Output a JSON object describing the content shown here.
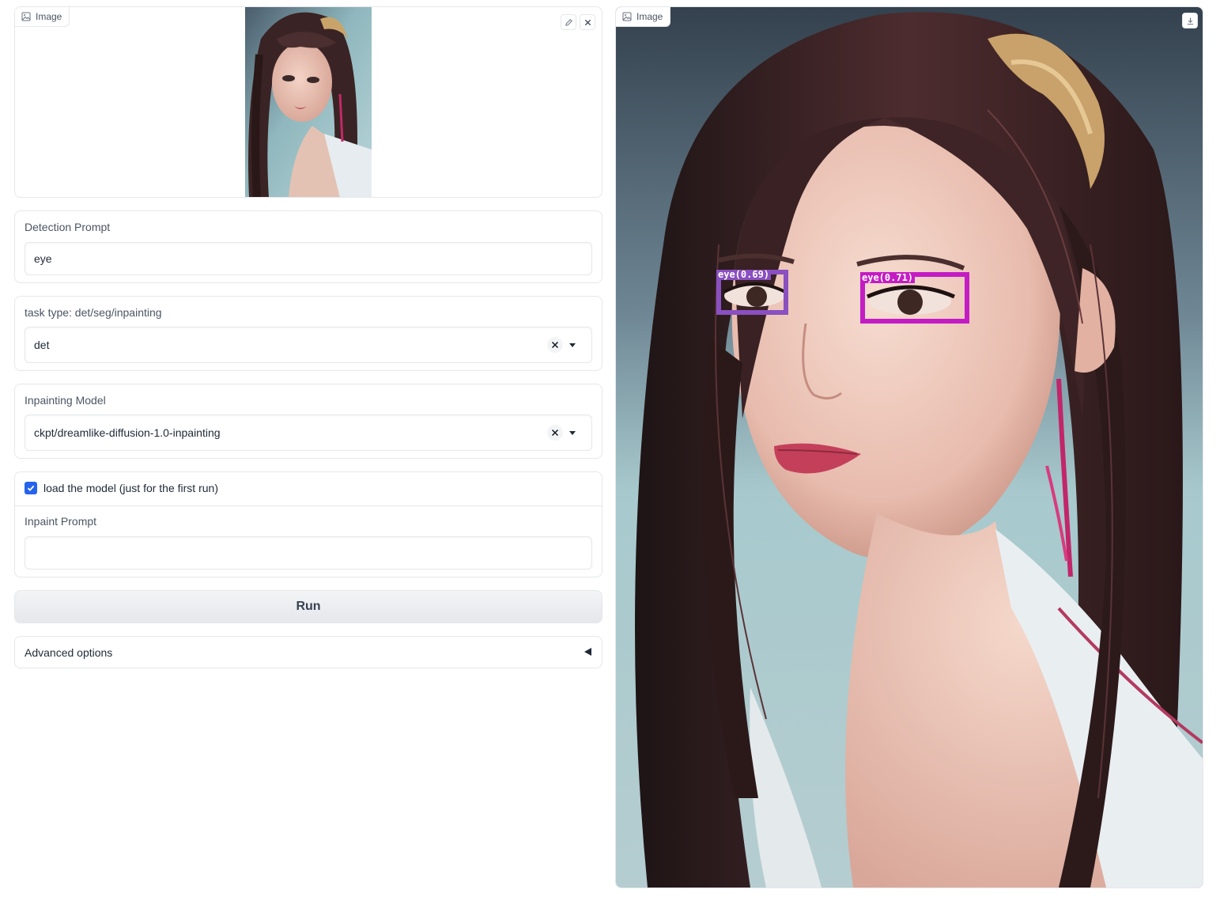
{
  "input_image": {
    "tag_label": "Image",
    "tag_icon": "image-icon",
    "edit_icon": "pencil-icon",
    "clear_icon": "close-icon"
  },
  "detection_prompt": {
    "label": "Detection Prompt",
    "value": "eye"
  },
  "task_type": {
    "label": "task type: det/seg/inpainting",
    "selected": "det"
  },
  "inpainting_model": {
    "label": "Inpainting Model",
    "selected": "ckpt/dreamlike-diffusion-1.0-inpainting"
  },
  "load_model": {
    "label": "load the model (just for the first run)",
    "checked": true
  },
  "inpaint_prompt": {
    "label": "Inpaint Prompt",
    "value": ""
  },
  "run_button": {
    "label": "Run"
  },
  "advanced_options": {
    "label": "Advanced options",
    "icon": "triangle-left-icon"
  },
  "output_image": {
    "tag_label": "Image",
    "tag_icon": "image-icon",
    "download_icon": "download-icon",
    "detections": [
      {
        "label": "eye(0.69)",
        "color": "#8a4fc0"
      },
      {
        "label": "eye(0.71)",
        "color": "#c41cc4"
      }
    ]
  },
  "colors": {
    "accent": "#2563eb",
    "border": "#e5e7eb",
    "run_button_bg": "#e5e7eb"
  }
}
